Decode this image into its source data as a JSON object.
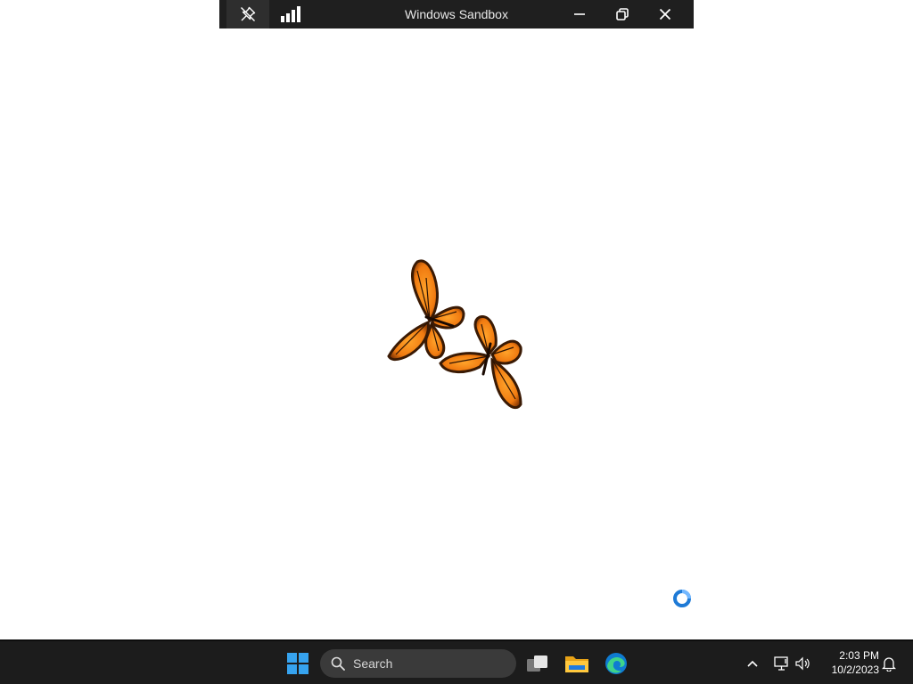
{
  "window": {
    "title": "Windows Sandbox",
    "toolbar": {
      "pin_icon": "unpin-icon",
      "connection_icon": "signal-bars-icon",
      "minimize_icon": "minimize-icon",
      "restore_icon": "restore-icon",
      "close_icon": "close-icon"
    }
  },
  "desktop": {
    "background_color": "#ffffff",
    "artwork": "two-orange-monarch-butterflies",
    "cursor": "busy-ring-cursor"
  },
  "taskbar": {
    "start_icon": "windows-start-icon",
    "search": {
      "label": "Search",
      "icon": "search-icon"
    },
    "pinned": [
      {
        "name": "Task View",
        "icon": "task-view-icon"
      },
      {
        "name": "File Explorer",
        "icon": "file-explorer-icon"
      },
      {
        "name": "Microsoft Edge",
        "icon": "edge-icon"
      }
    ],
    "tray": {
      "overflow_icon": "chevron-up-icon",
      "network_icon": "network-icon",
      "volume_icon": "volume-icon",
      "notification_icon": "bell-icon"
    },
    "clock": {
      "time": "2:03 PM",
      "date": "10/2/2023"
    }
  }
}
